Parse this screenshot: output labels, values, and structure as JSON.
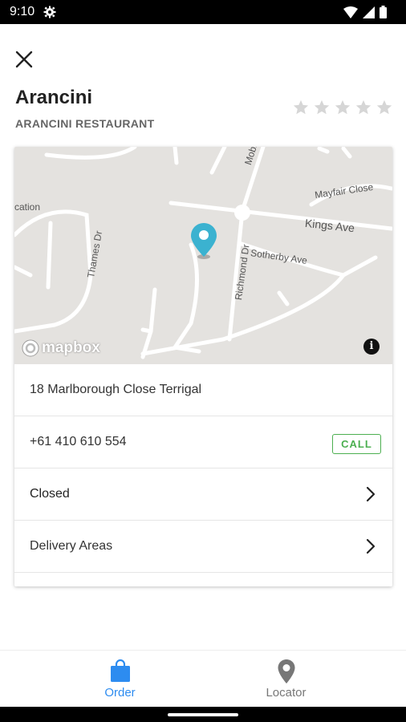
{
  "status_bar": {
    "time": "9:10",
    "icons": [
      "gear-icon",
      "wifi-icon",
      "signal-icon",
      "battery-icon"
    ]
  },
  "header": {
    "close_icon": "close-icon"
  },
  "restaurant": {
    "name": "Arancini",
    "subtitle": "ARANCINI RESTAURANT",
    "rating": {
      "value": 0,
      "max": 5,
      "icon": "star-icon"
    }
  },
  "map": {
    "labels": {
      "mobbs": "Mobbs Rd",
      "mayfair": "Mayfair Close",
      "kings": "Kings Ave",
      "thames": "Thames Dr",
      "sotherby": "Sotherby Ave",
      "richmond": "Richmond Dr",
      "location_partial": "cation"
    },
    "logo_text": "mapbox",
    "info_label": "i",
    "pin_color": "#3bb2d0"
  },
  "details": {
    "address": "18 Marlborough Close Terrigal",
    "phone": "+61 410 610 554",
    "call_label": "CALL",
    "hours": "Closed",
    "delivery": "Delivery Areas"
  },
  "bottom_nav": {
    "items": [
      {
        "label": "Order",
        "icon": "shopping-bag-icon",
        "active": true
      },
      {
        "label": "Locator",
        "icon": "location-pin-icon",
        "active": false
      }
    ]
  },
  "colors": {
    "accent": "#2d8cf0",
    "inactive": "#777777",
    "call": "#4caf50",
    "pin": "#3bb2d0"
  }
}
